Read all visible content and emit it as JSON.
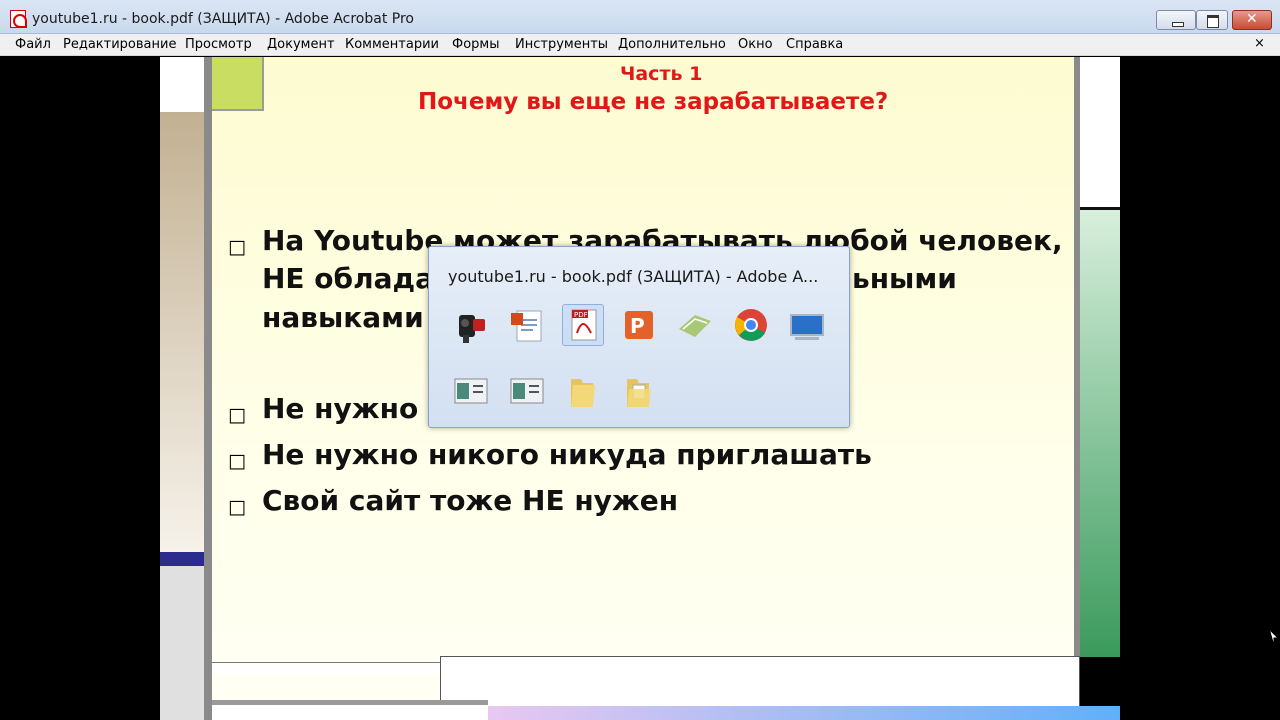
{
  "window": {
    "title": "youtube1.ru - book.pdf (ЗАЩИТА) - Adobe Acrobat Pro"
  },
  "menu": {
    "items": [
      "Файл",
      "Редактирование",
      "Просмотр",
      "Документ",
      "Комментарии",
      "Формы",
      "Инструменты",
      "Дополнительно",
      "Окно",
      "Справка"
    ],
    "close_glyph": "×"
  },
  "slide": {
    "part_label": "Часть 1",
    "title": "Почему вы еще не зарабатываете?",
    "bullets": [
      "На Youtube может зарабатывать любой человек,",
      "НЕ облада",
      "ьными",
      "навыками",
      "Не нужно",
      "Не нужно никого никуда приглашать",
      "Свой сайт тоже НЕ нужен"
    ],
    "bullet_glyph": "□"
  },
  "taskbar_popup": {
    "title": "youtube1.ru - book.pdf (ЗАЩИТА) - Adobe A...",
    "icons_row1": [
      "camcorder-icon",
      "powerpoint-doc-icon",
      "pdf-acrobat-icon",
      "powerpoint-icon",
      "map-app-icon",
      "chrome-icon",
      "monitor-icon"
    ],
    "icons_row2": [
      "window-preview-icon",
      "window-preview-icon",
      "folder-icon",
      "folder-doc-icon"
    ],
    "pdf_badge": "PDF",
    "selected_icon": "pdf-acrobat-icon"
  },
  "colors": {
    "title_red": "#e01818",
    "green_block": "#c8dd62",
    "window_frame": "#c9d9ee"
  }
}
